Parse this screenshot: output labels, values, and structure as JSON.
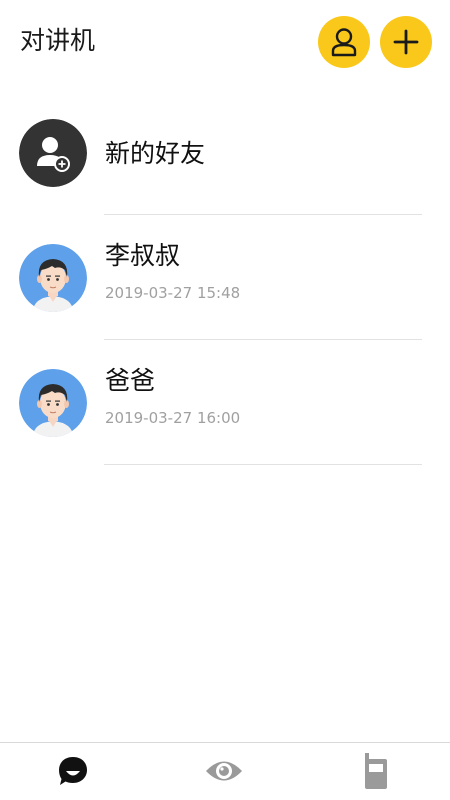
{
  "header": {
    "title": "对讲机",
    "contacts_icon": "person-icon",
    "add_icon": "plus-icon",
    "accent_color": "#f9c81b"
  },
  "contacts": [
    {
      "name": "新的好友",
      "icon": "add-friend-icon"
    },
    {
      "name": "李叔叔",
      "timestamp": "2019-03-27 15:48",
      "icon": "avatar-boy"
    },
    {
      "name": "爸爸",
      "timestamp": "2019-03-27 16:00",
      "icon": "avatar-boy"
    }
  ],
  "tabbar": {
    "tabs": [
      {
        "icon": "chat-bubble-icon",
        "active": true
      },
      {
        "icon": "eye-icon",
        "active": false
      },
      {
        "icon": "walkie-talkie-icon",
        "active": false
      }
    ]
  }
}
